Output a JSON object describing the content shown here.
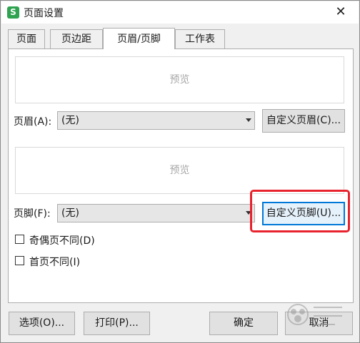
{
  "dialog": {
    "app_icon_letter": "S",
    "title": "页面设置",
    "close_glyph": "✕"
  },
  "tabs": [
    {
      "label": "页面"
    },
    {
      "label": "页边距"
    },
    {
      "label": "页眉/页脚",
      "active": true
    },
    {
      "label": "工作表"
    }
  ],
  "header": {
    "preview_label": "预览",
    "field_label": "页眉(A):",
    "selected_value": "(无)",
    "custom_button": "自定义页眉(C)..."
  },
  "footer": {
    "preview_label": "预览",
    "field_label": "页脚(F):",
    "selected_value": "(无)",
    "custom_button": "自定义页脚(U)..."
  },
  "options": {
    "odd_even_label": "奇偶页不同(D)",
    "odd_even_checked": false,
    "first_page_label": "首页不同(I)",
    "first_page_checked": false
  },
  "buttons": {
    "options": "选项(O)...",
    "print": "打印(P)...",
    "ok": "确定",
    "cancel": "取消"
  },
  "colors": {
    "highlight": "#e8232d",
    "app_icon": "#2fa34f",
    "focus": "#0078d7"
  }
}
